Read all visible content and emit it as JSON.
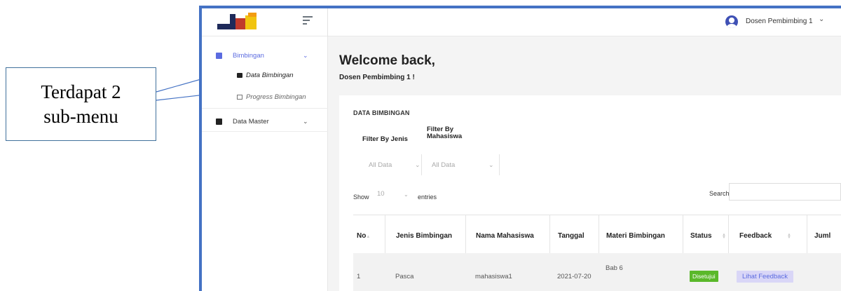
{
  "annotation": {
    "line1": "Terdapat 2",
    "line2": "sub-menu"
  },
  "header": {
    "user_name": "Dosen Pembimbing 1",
    "user_chevron": "⌄"
  },
  "sidebar": {
    "items": [
      {
        "label": "Bimbingan",
        "icon": "folder-icon",
        "chevron": "⌄",
        "sub_items": [
          {
            "label": "Data Bimbingan",
            "icon": "camera-icon"
          },
          {
            "label": "Progress Bimbingan",
            "icon": "calendar-icon"
          }
        ]
      },
      {
        "label": "Data Master",
        "icon": "archive-icon",
        "chevron": "⌄"
      }
    ]
  },
  "main": {
    "welcome_title": "Welcome back,",
    "welcome_subtitle": "Dosen Pembimbing 1 !",
    "card_title": "DATA BIMBINGAN",
    "tabs": [
      "Filter By Jenis",
      "Filter By",
      "Mahasiswa"
    ],
    "filters": [
      {
        "value": "All Data"
      },
      {
        "value": "All Data"
      }
    ],
    "length": {
      "show": "Show",
      "value": "10",
      "entries": "entries"
    },
    "search_label": "Search:",
    "table": {
      "columns": [
        "No",
        "Jenis Bimbingan",
        "Nama Mahasiswa",
        "Tanggal",
        "Materi Bimbingan",
        "Status",
        "Feedback",
        "Juml"
      ],
      "rows": [
        {
          "no": "1",
          "jenis": "Pasca",
          "nama": "mahasiswa1",
          "tanggal": "2021-07-20",
          "materi": "Bab 6",
          "status": "Disetujui",
          "feedback": "Lihat Feedback"
        }
      ]
    }
  },
  "colors": {
    "accent": "#5b6be0",
    "frame_border": "#4472c4",
    "status_ok": "#5ab82a"
  }
}
